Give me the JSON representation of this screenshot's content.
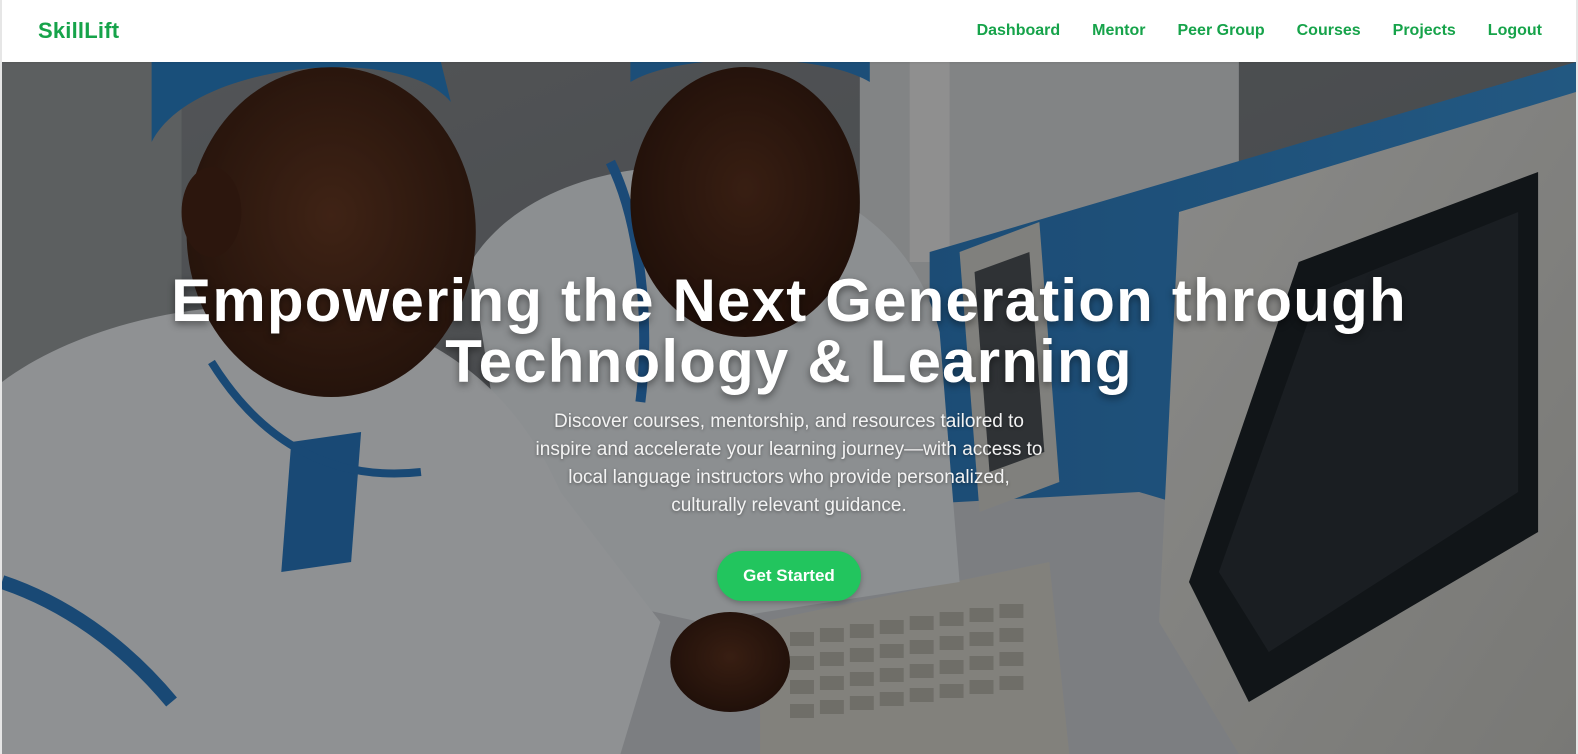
{
  "navbar": {
    "brand": "SkillLift",
    "links": [
      {
        "label": "Dashboard"
      },
      {
        "label": "Mentor"
      },
      {
        "label": "Peer Group"
      },
      {
        "label": "Courses"
      },
      {
        "label": "Projects"
      },
      {
        "label": "Logout"
      }
    ]
  },
  "hero": {
    "title": "Empowering the Next Generation through Technology & Learning",
    "subtitle": "Discover courses, mentorship, and resources tailored to inspire and accelerate your learning journey—with access to local language instructors who provide personalized, culturally relevant guidance.",
    "cta_label": "Get Started"
  },
  "colors": {
    "brand_green": "#16a34a",
    "button_green": "#22c55e",
    "overlay": "rgba(0,0,0,0.40)"
  }
}
